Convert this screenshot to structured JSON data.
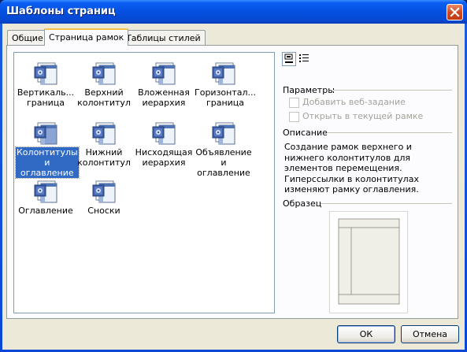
{
  "window": {
    "title": "Шаблоны страниц"
  },
  "tabs": [
    {
      "label": "Общие",
      "active": false
    },
    {
      "label": "Страница рамок",
      "active": true
    },
    {
      "label": "Таблицы стилей",
      "active": false
    }
  ],
  "templates": [
    {
      "label": "Вертикаль...\nграница",
      "icon": "vertical-border-icon",
      "selected": false
    },
    {
      "label": "Верхний\nколонтитул",
      "icon": "top-header-icon",
      "selected": false
    },
    {
      "label": "Вложенная\nиерархия",
      "icon": "nested-hierarchy-icon",
      "selected": false
    },
    {
      "label": "Горизонтал...\nграница",
      "icon": "horizontal-border-icon",
      "selected": false
    },
    {
      "label": "Колонтитулы\nи оглавление",
      "icon": "headers-contents-icon",
      "selected": true
    },
    {
      "label": "Нижний\nколонтитул",
      "icon": "bottom-footer-icon",
      "selected": false
    },
    {
      "label": "Нисходящая\nиерархия",
      "icon": "descending-hierarchy-icon",
      "selected": false
    },
    {
      "label": "Объявление\nи оглавление",
      "icon": "banner-contents-icon",
      "selected": false
    },
    {
      "label": "Оглавление",
      "icon": "contents-icon",
      "selected": false
    },
    {
      "label": "Сноски",
      "icon": "footnotes-icon",
      "selected": false
    }
  ],
  "view_buttons": {
    "large_icons": "large-icons-view-icon",
    "details": "details-view-icon"
  },
  "options": {
    "title": "Параметры",
    "items": [
      {
        "label": "Добавить веб-задание",
        "checked": false,
        "enabled": false
      },
      {
        "label": "Открыть в текущей рамке",
        "checked": false,
        "enabled": false
      }
    ]
  },
  "description": {
    "title": "Описание",
    "text": "Создание рамок верхнего и нижнего колонтитулов для элементов перемещения. Гиперссылки в колонтитулах изменяют рамку оглавления."
  },
  "preview": {
    "title": "Образец"
  },
  "buttons": {
    "ok": "ОК",
    "cancel": "Отмена"
  },
  "colors": {
    "selection": "#316ac5",
    "titlebar": "#0550e0",
    "dialog": "#ece9d8"
  }
}
